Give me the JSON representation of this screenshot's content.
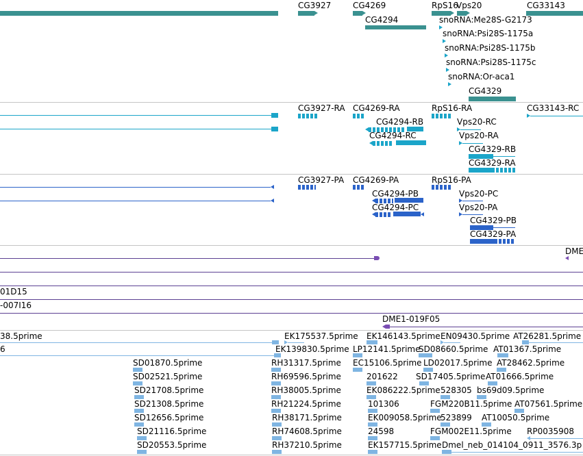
{
  "colors": {
    "gene": "#3a9190",
    "transcript": "#1ba5c9",
    "protein": "#2b63c9",
    "clone_line": "#5b3f92",
    "clone_mark": "#7a4db3",
    "est": "#7fb5e2",
    "separator": "#c4c4c4"
  },
  "gene_track": {
    "labels": [
      "CG3927",
      "CG4269",
      "RpS16",
      "Vps20",
      "CG33143",
      "CG4294",
      "snoRNA:Me28S-G2173",
      "snoRNA:Psi28S-1175a",
      "snoRNA:Psi28S-1175b",
      "snoRNA:Psi28S-1175c",
      "snoRNA:Or-aca1",
      "CG4329"
    ]
  },
  "transcript_track": {
    "labels": [
      "CG3927-RA",
      "CG4269-RA",
      "RpS16-RA",
      "CG33143-RC",
      "CG4294-RB",
      "Vps20-RC",
      "CG4294-RC",
      "Vps20-RA",
      "CG4329-RB",
      "CG4329-RA"
    ]
  },
  "protein_track": {
    "labels": [
      "CG3927-PA",
      "CG4269-PA",
      "RpS16-PA",
      "CG4294-PB",
      "Vps20-PC",
      "CG4294-PC",
      "Vps20-PA",
      "CG4329-PB",
      "CG4329-PA"
    ]
  },
  "clone_track": {
    "labels": [
      "DME",
      "01D15",
      "-007I16",
      "DME1-019F05"
    ]
  },
  "est_track": {
    "labels": [
      "38.5prime",
      "EK175537.5prime",
      "EK146143.5prime",
      "EN09430.5prime",
      "AT26281.5prime",
      "6",
      "EK139830.5prime",
      "LP12141.5prime",
      "SD08660.5prime",
      "AT01367.5prime",
      "SD01870.5prime",
      "RH31317.5prime",
      "EC15106.5prime",
      "LD02017.5prime",
      "AT28462.5prime",
      "SD02521.5prime",
      "RH69596.5prime",
      "201622",
      "SD17405.5prime",
      "AT01666.5prime",
      "SD21708.5prime",
      "RH38005.5prime",
      "EK086222.5prime",
      "528305",
      "bs69d09.5prime",
      "SD21308.5prime",
      "RH21224.5prime",
      "101306",
      "FGM220B11.5prime",
      "AT07561.5prime",
      "SD12656.5prime",
      "RH38171.5prime",
      "EK009058.5prime",
      "523899",
      "AT10050.5prime",
      "SD21116.5prime",
      "RH74608.5prime",
      "24598",
      "FGM002E11.5prime",
      "RP0035908",
      "SD20553.5prime",
      "RH37210.5prime",
      "EK157715.5prime",
      "Dmel_neb_014104_0911_3576.3p"
    ]
  }
}
